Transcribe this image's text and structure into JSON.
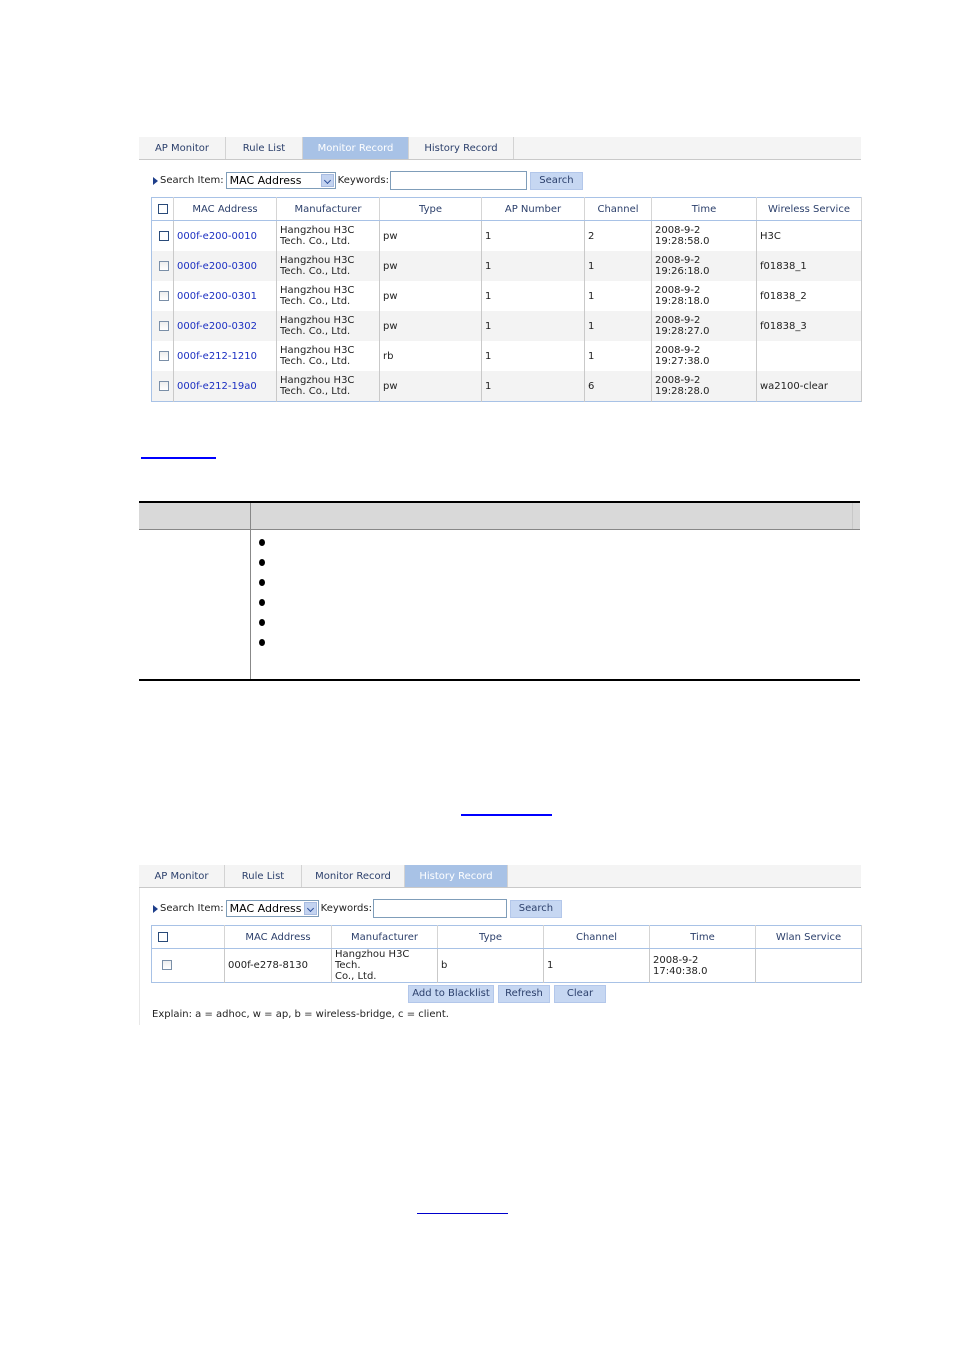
{
  "figure1": {
    "tabs": [
      {
        "label": "AP Monitor",
        "active": false
      },
      {
        "label": "Rule List",
        "active": false
      },
      {
        "label": "Monitor Record",
        "active": true
      },
      {
        "label": "History Record",
        "active": false
      }
    ],
    "search": {
      "label": "Search Item:",
      "selected": "MAC Address",
      "keywords_label": "Keywords:",
      "keywords_value": "",
      "button": "Search"
    },
    "columns": [
      "MAC Address",
      "Manufacturer",
      "Type",
      "AP Number",
      "Channel",
      "Time",
      "Wireless Service"
    ],
    "rows": [
      {
        "mac": "000f-e200-0010",
        "manufacturer_l1": "Hangzhou H3C",
        "manufacturer_l2": "Tech. Co., Ltd.",
        "type": "pw",
        "ap_number": "1",
        "channel": "2",
        "time": "2008-9-2 19:28:58.0",
        "service": "H3C"
      },
      {
        "mac": "000f-e200-0300",
        "manufacturer_l1": "Hangzhou H3C",
        "manufacturer_l2": "Tech. Co., Ltd.",
        "type": "pw",
        "ap_number": "1",
        "channel": "1",
        "time": "2008-9-2 19:26:18.0",
        "service": "f01838_1"
      },
      {
        "mac": "000f-e200-0301",
        "manufacturer_l1": "Hangzhou H3C",
        "manufacturer_l2": "Tech. Co., Ltd.",
        "type": "pw",
        "ap_number": "1",
        "channel": "1",
        "time": "2008-9-2 19:28:18.0",
        "service": "f01838_2"
      },
      {
        "mac": "000f-e200-0302",
        "manufacturer_l1": "Hangzhou H3C",
        "manufacturer_l2": "Tech. Co., Ltd.",
        "type": "pw",
        "ap_number": "1",
        "channel": "1",
        "time": "2008-9-2 19:28:27.0",
        "service": "f01838_3"
      },
      {
        "mac": "000f-e212-1210",
        "manufacturer_l1": "Hangzhou H3C",
        "manufacturer_l2": "Tech. Co., Ltd.",
        "type": "rb",
        "ap_number": "1",
        "channel": "1",
        "time": "2008-9-2 19:27:38.0",
        "service": ""
      },
      {
        "mac": "000f-e212-19a0",
        "manufacturer_l1": "Hangzhou H3C",
        "manufacturer_l2": "Tech. Co., Ltd.",
        "type": "pw",
        "ap_number": "1",
        "channel": "6",
        "time": "2008-9-2 19:28:28.0",
        "service": "wa2100-clear"
      }
    ]
  },
  "figure2": {
    "tabs": [
      {
        "label": "AP Monitor",
        "active": false
      },
      {
        "label": "Rule List",
        "active": false
      },
      {
        "label": "Monitor Record",
        "active": false
      },
      {
        "label": "History Record",
        "active": true
      }
    ],
    "search": {
      "label": "Search Item:",
      "selected": "MAC Address",
      "keywords_label": "Keywords:",
      "keywords_value": "",
      "button": "Search"
    },
    "columns": [
      "MAC Address",
      "Manufacturer",
      "Type",
      "Channel",
      "Time",
      "Wlan Service"
    ],
    "rows": [
      {
        "mac": "000f-e278-8130",
        "manufacturer_l1": "Hangzhou H3C Tech.",
        "manufacturer_l2": "Co., Ltd.",
        "type": "b",
        "channel": "1",
        "time": "2008-9-2 17:40:38.0",
        "service": ""
      }
    ],
    "buttons": {
      "add_blacklist": "Add to Blacklist",
      "refresh": "Refresh",
      "clear": "Clear"
    },
    "explain": "Explain: a = adhoc, w = ap, b = wireless-bridge, c = client."
  },
  "description_table": {
    "bullet_count": 6
  },
  "colors": {
    "active_tab": "#a8c2e6",
    "link": "#1b2fc2",
    "hyperlink_underline": "#0000ff",
    "button_bg": "#c6d7f2"
  }
}
